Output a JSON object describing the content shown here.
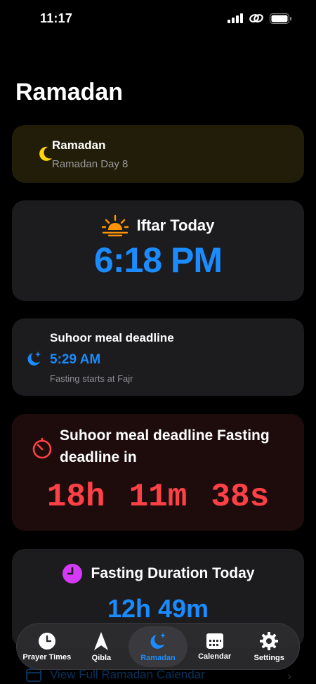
{
  "status": {
    "time": "11:17"
  },
  "page": {
    "title": "Ramadan"
  },
  "ramadan_card": {
    "title": "Ramadan",
    "subtitle": "Ramadan Day 8"
  },
  "iftar": {
    "title": "Iftar Today",
    "time": "6:18 PM"
  },
  "suhoor": {
    "title": "Suhoor meal deadline",
    "time": "5:29 AM",
    "note": "Fasting starts at Fajr"
  },
  "countdown": {
    "title": "Suhoor meal deadline Fasting deadline in",
    "hours": "18h",
    "minutes": "11m",
    "seconds": "38s"
  },
  "duration": {
    "title": "Fasting Duration Today",
    "value": "12h 49m"
  },
  "calendar_link": {
    "label": "View Full Ramadan Calendar"
  },
  "tabs": [
    {
      "label": "Prayer Times",
      "icon": "clock-icon",
      "active": false
    },
    {
      "label": "Qibla",
      "icon": "compass-arrow-icon",
      "active": false
    },
    {
      "label": "Ramadan",
      "icon": "moon-stars-icon",
      "active": true
    },
    {
      "label": "Calendar",
      "icon": "calendar-icon",
      "active": false
    },
    {
      "label": "Settings",
      "icon": "gear-icon",
      "active": false
    }
  ],
  "colors": {
    "accent": "#1a8cff",
    "countdown": "#ff4046",
    "moon": "#ffd60a",
    "sunset": "#ff9500",
    "duration_icon": "#d63af9"
  }
}
